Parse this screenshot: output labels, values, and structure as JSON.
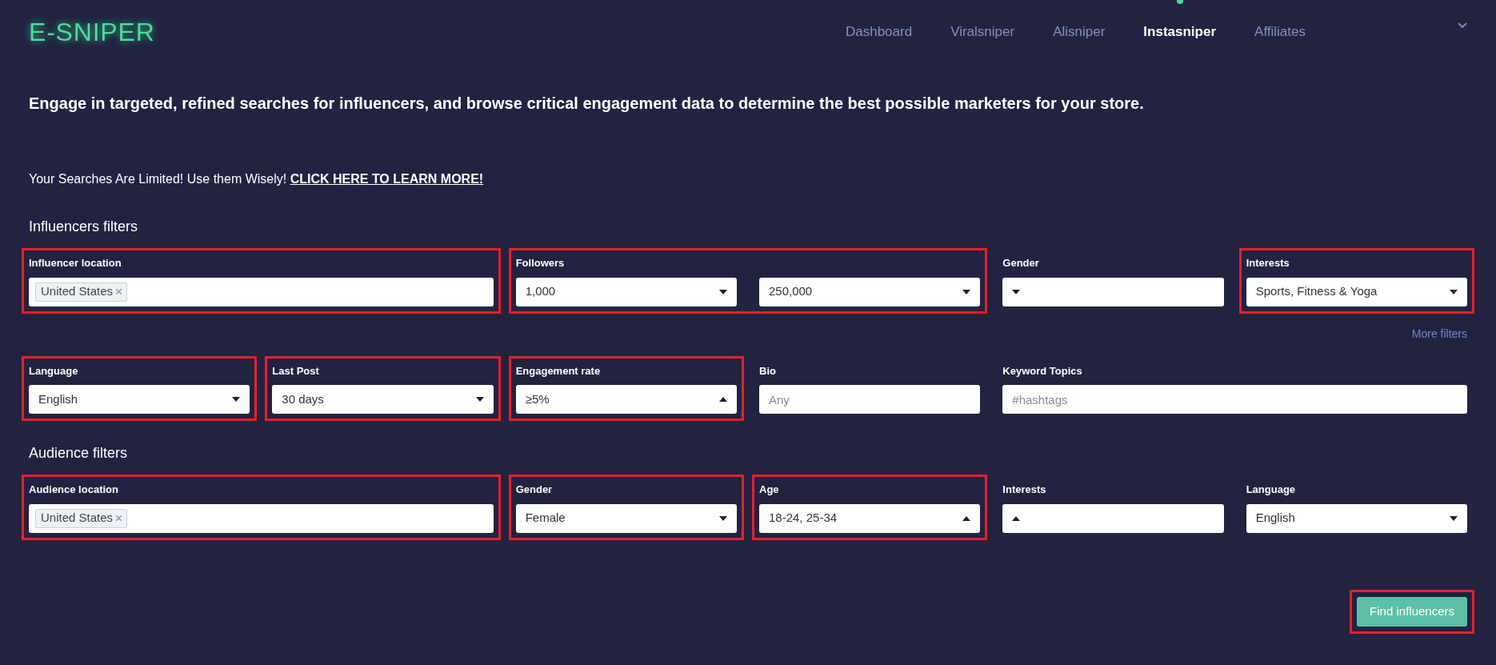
{
  "logo": "E-SNIPER",
  "nav": [
    {
      "label": "Dashboard",
      "selected": false
    },
    {
      "label": "Viralsniper",
      "selected": false
    },
    {
      "label": "Alisniper",
      "selected": false
    },
    {
      "label": "Instasniper",
      "selected": true
    },
    {
      "label": "Affiliates",
      "selected": false
    }
  ],
  "headline": "Engage in targeted, refined searches for influencers, and browse critical engagement data to determine the best possible marketers for your store.",
  "notice": {
    "text": "Your Searches Are Limited! Use them Wisely! ",
    "link": "CLICK HERE TO LEARN MORE!"
  },
  "sections": [
    {
      "title": "Influencers filters",
      "lines": [
        [
          {
            "kind": "tags",
            "label": "Influencer location",
            "tags": [
              "United States"
            ],
            "highlighted": true
          },
          {
            "kind": "range",
            "label": "Followers",
            "min": {
              "value": "1,000",
              "open": false
            },
            "max": {
              "value": "250,000",
              "open": false
            },
            "highlighted": true
          },
          {
            "kind": "select",
            "label": "Gender",
            "open": false,
            "highlighted": false
          },
          {
            "kind": "select",
            "label": "Interests",
            "value": "Sports, Fitness & Yoga",
            "open": false,
            "highlighted": true
          }
        ],
        [
          {
            "kind": "select",
            "label": "Language",
            "value": "English",
            "open": false,
            "highlighted": true
          },
          {
            "kind": "select",
            "label": "Last Post",
            "value": "30 days",
            "open": false,
            "highlighted": true
          },
          {
            "kind": "select",
            "label": "Engagement rate",
            "value": "≥5%",
            "open": true,
            "highlighted": true
          },
          {
            "kind": "text",
            "label": "Bio",
            "placeholder": "Any",
            "highlighted": false
          },
          {
            "kind": "text",
            "label": "Keyword Topics",
            "placeholder": "#hashtags",
            "highlighted": false
          }
        ]
      ],
      "more_link": "More filters"
    },
    {
      "title": "Audience filters",
      "lines": [
        [
          {
            "kind": "tags",
            "label": "Audience location",
            "tags": [
              "United States"
            ],
            "highlighted": true
          },
          {
            "kind": "select",
            "label": "Gender",
            "value": "Female",
            "open": false,
            "highlighted": true
          },
          {
            "kind": "select",
            "label": "Age",
            "value": "18-24, 25-34",
            "open": true,
            "highlighted": true
          },
          {
            "kind": "select",
            "label": "Interests",
            "open": true,
            "highlighted": false
          },
          {
            "kind": "select",
            "label": "Language",
            "value": "English",
            "open": false,
            "highlighted": false
          }
        ]
      ]
    }
  ],
  "submit": {
    "label": "Find influencers",
    "highlighted": true
  }
}
